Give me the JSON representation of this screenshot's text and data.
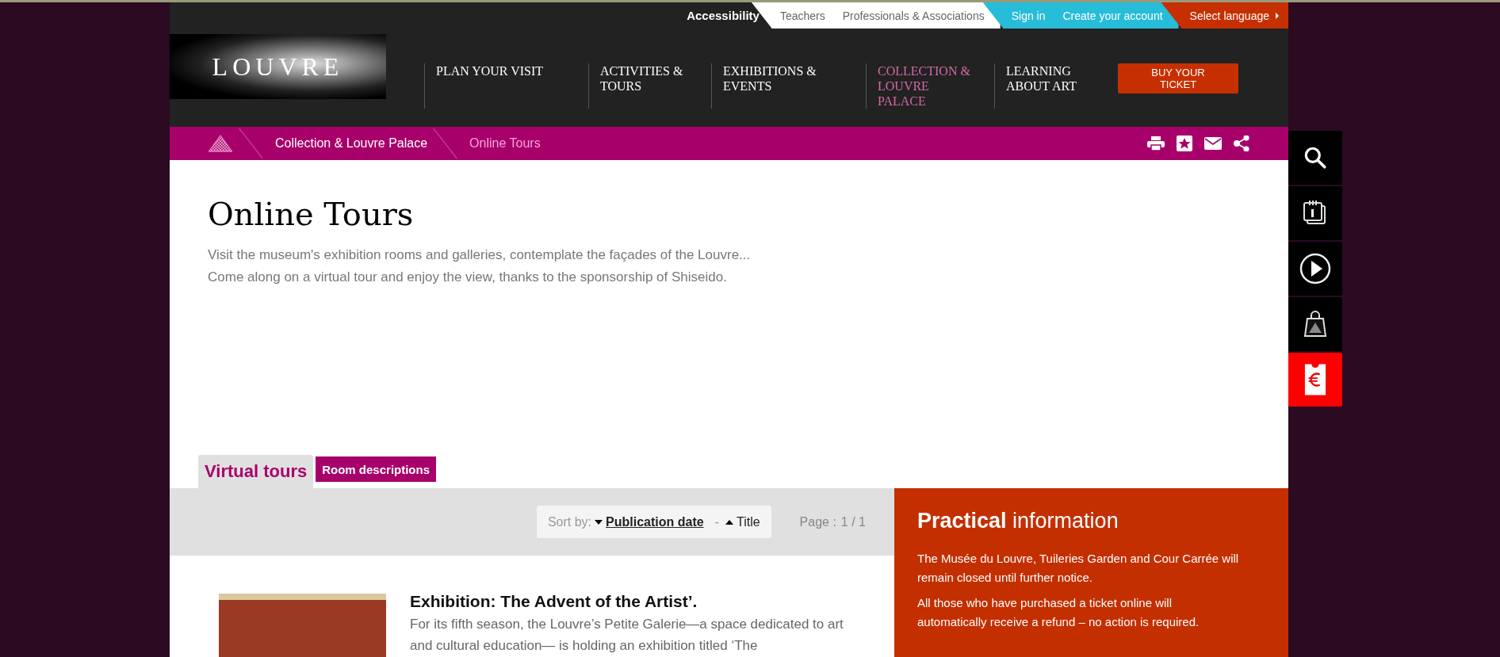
{
  "top_bar": {
    "accessibility": "Accessibility",
    "groups": [
      {
        "kind": "audience",
        "links": [
          "Teachers",
          "Professionals & Associations"
        ]
      },
      {
        "kind": "account",
        "links": [
          "Sign in",
          "Create your account"
        ]
      },
      {
        "kind": "language",
        "links": [
          "Select language"
        ]
      }
    ]
  },
  "logo": "LOUVRE",
  "nav": [
    {
      "label": "PLAN YOUR VISIT",
      "selected": false
    },
    {
      "label": "ACTIVITIES & TOURS",
      "selected": false
    },
    {
      "label": "EXHIBITIONS & EVENTS",
      "selected": false
    },
    {
      "label": "COLLECTION & LOUVRE PALACE",
      "selected": true
    },
    {
      "label": "LEARNING ABOUT ART",
      "selected": false
    }
  ],
  "buy_button": "BUY YOUR TICKET",
  "breadcrumb": [
    {
      "label": "Collection & Louvre Palace",
      "current": false
    },
    {
      "label": "Online Tours",
      "current": true
    }
  ],
  "page": {
    "title": "Online Tours",
    "intro": [
      "Visit the museum's exhibition rooms and galleries, contemplate the façades of the Louvre...",
      "Come along on a virtual tour and enjoy the view, thanks to the sponsorship of Shiseido."
    ]
  },
  "tabs": [
    {
      "label": "Virtual tours",
      "selected": true
    },
    {
      "label": "Room descriptions",
      "selected": false
    }
  ],
  "sort": {
    "label": "Sort by:",
    "options": [
      {
        "label": "Publication date",
        "kind": "down",
        "selected": true
      },
      {
        "label": "Title",
        "kind": "up",
        "selected": false
      }
    ],
    "separator": "-"
  },
  "pagination": {
    "label": "Page :",
    "value": "1 / 1"
  },
  "article": {
    "title": "Exhibition: The Advent of the Artist’.",
    "text": "For its fifth season, the Louvre’s Petite Galerie—a space dedicated to art and cultural education— is holding an exhibition titled ‘The"
  },
  "practical": {
    "title": "**Practical** information",
    "paragraphs": [
      "The Musée du Louvre, Tuileries Garden and Cour Carrée will remain closed until further notice.",
      "All those who have purchased a ticket online will automatically receive a refund – no action is required."
    ]
  }
}
